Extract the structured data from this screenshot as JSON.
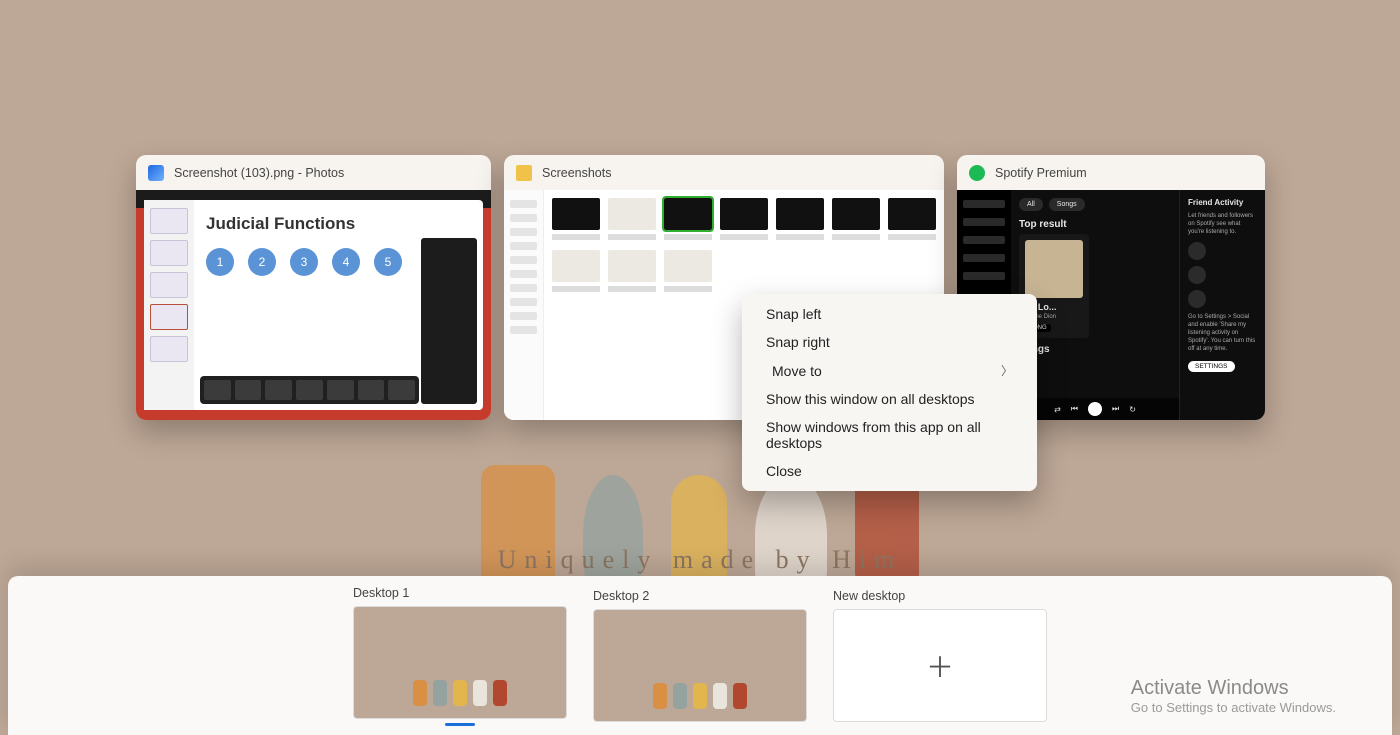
{
  "wallpaper": {
    "tagline": "Uniquely made by Him"
  },
  "windows": [
    {
      "title": "Screenshot (103).png - Photos",
      "slide_title": "Judicial Functions"
    },
    {
      "title": "Screenshots"
    },
    {
      "title": "Spotify Premium",
      "top_result_label": "Top result",
      "track_title": "To Lo...",
      "artist": "Celine Dion",
      "tag": "SONG",
      "songs_label": "Songs",
      "pill_all": "All",
      "pill_songs": "Songs",
      "friend_title": "Friend Activity",
      "friend_text": "Let friends and followers on Spotify see what you're listening to.",
      "friend_hint": "Go to Settings > Social and enable 'Share my listening activity on Spotify'. You can turn this off at any time.",
      "settings_btn": "SETTINGS"
    }
  ],
  "context_menu": {
    "items": [
      "Snap left",
      "Snap right",
      "Move to",
      "Show this window on all desktops",
      "Show windows from this app on all desktops",
      "Close"
    ]
  },
  "desktops": {
    "d1": "Desktop 1",
    "d2": "Desktop 2",
    "new": "New desktop"
  },
  "watermark": {
    "line1": "Activate Windows",
    "line2": "Go to Settings to activate Windows."
  }
}
